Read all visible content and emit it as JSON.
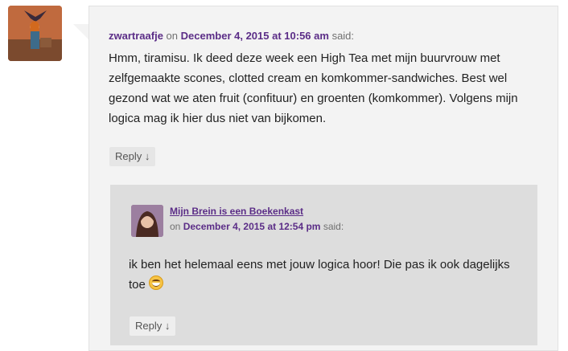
{
  "comment": {
    "author": "zwartraafje",
    "on_text": "on",
    "date": "December 4, 2015 at 10:56 am",
    "said_text": "said:",
    "body": "Hmm, tiramisu. Ik deed deze week een High Tea met mijn buurvrouw met zelfgemaakte scones, clotted cream en komkommer-sandwiches. Best wel gezond wat we aten fruit (confituur) en groenten (komkommer). Volgens mijn logica mag ik hier dus niet van bijkomen.",
    "reply_label": "Reply ↓"
  },
  "reply": {
    "author": "Mijn Brein is een Boekenkast",
    "on_text": "on",
    "date": "December 4, 2015 at 12:54 pm",
    "said_text": "said:",
    "body": "ik ben het helemaal eens met jouw logica hoor! Die pas ik ook dagelijks toe",
    "emoji_icon": "grinning-face-icon",
    "reply_label": "Reply ↓"
  },
  "colors": {
    "link": "#5b2d87",
    "comment_bg": "#f3f3f3",
    "nested_bg": "#dddddd"
  }
}
